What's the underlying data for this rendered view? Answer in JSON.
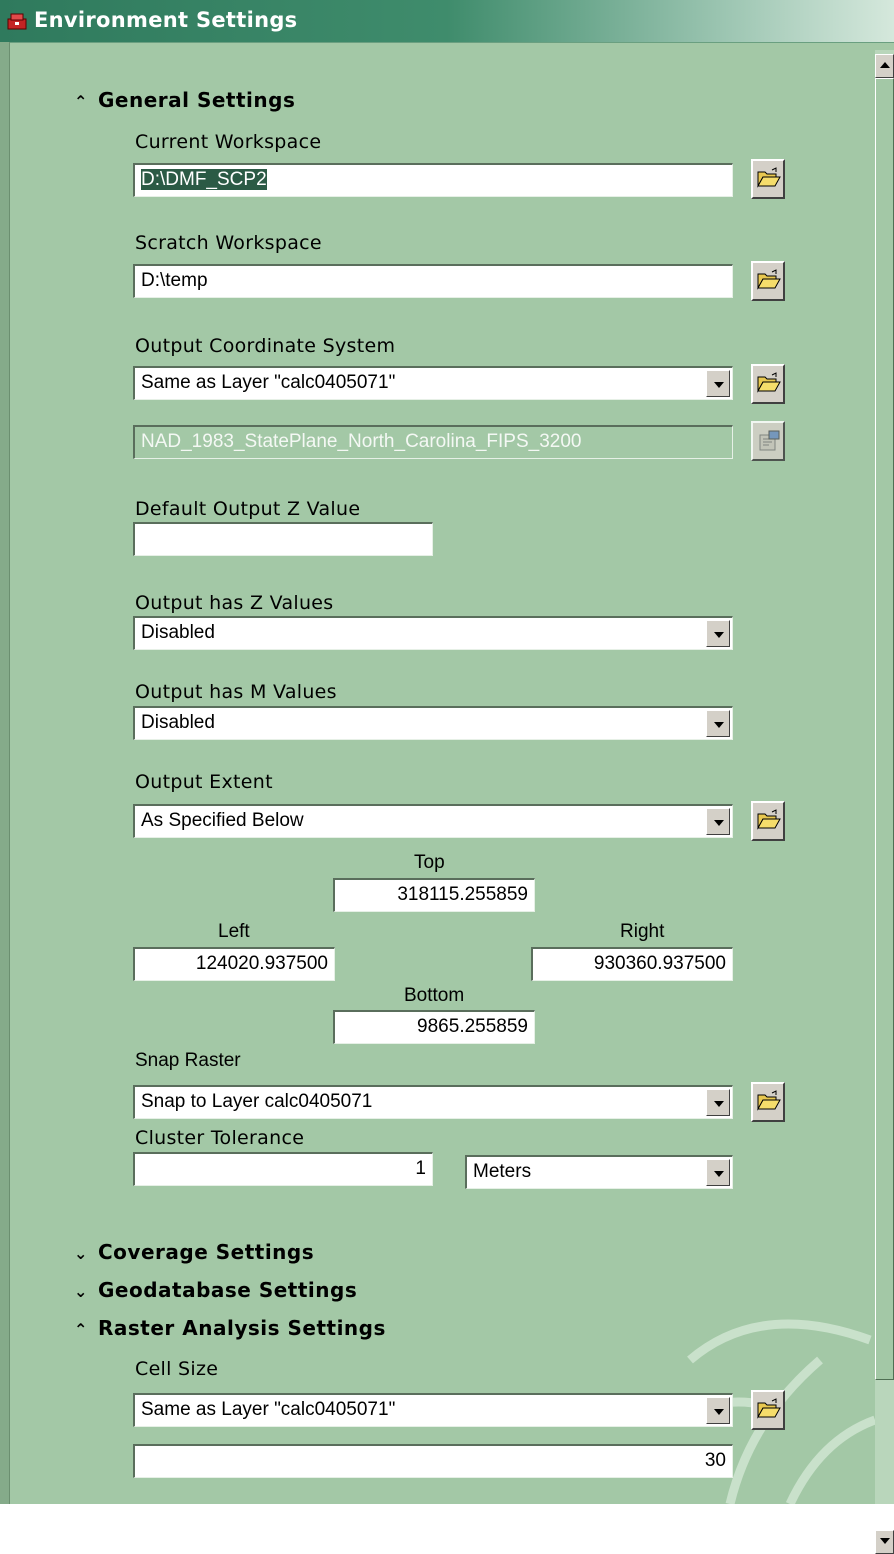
{
  "window": {
    "title": "Environment Settings"
  },
  "sections": {
    "general": {
      "label": "General Settings",
      "state": "expanded"
    },
    "coverage": {
      "label": "Coverage Settings",
      "state": "collapsed"
    },
    "geodatabase": {
      "label": "Geodatabase Settings",
      "state": "collapsed"
    },
    "raster": {
      "label": "Raster Analysis Settings",
      "state": "expanded"
    }
  },
  "general": {
    "current_workspace": {
      "label": "Current Workspace",
      "value": "D:\\DMF_SCP2"
    },
    "scratch_workspace": {
      "label": "Scratch Workspace",
      "value": "D:\\temp"
    },
    "output_coord": {
      "label": "Output Coordinate System",
      "value": "Same as Layer \"calc0405071\"",
      "projection": "NAD_1983_StatePlane_North_Carolina_FIPS_3200"
    },
    "default_z": {
      "label": "Default Output Z Value",
      "value": ""
    },
    "has_z": {
      "label": "Output has Z Values",
      "value": "Disabled"
    },
    "has_m": {
      "label": "Output has M Values",
      "value": "Disabled"
    },
    "extent": {
      "label": "Output Extent",
      "value": "As Specified Below",
      "top_label": "Top",
      "top": "318115.255859",
      "left_label": "Left",
      "left": "124020.937500",
      "right_label": "Right",
      "right": "930360.937500",
      "bottom_label": "Bottom",
      "bottom": "9865.255859"
    },
    "snap_raster": {
      "label": "Snap Raster",
      "value": "Snap to Layer calc0405071"
    },
    "cluster_tolerance": {
      "label": "Cluster Tolerance",
      "value": "1",
      "units": "Meters"
    }
  },
  "raster": {
    "cell_size": {
      "label": "Cell Size",
      "value": "Same as Layer \"calc0405071\"",
      "number": "30"
    }
  },
  "icons": {
    "title": "toolbox-icon",
    "browse": "open-folder-icon",
    "properties": "properties-icon"
  },
  "colors": {
    "background": "#a3c8a6",
    "titlebar": "#2f7a5d",
    "selection": "#2b5a45"
  }
}
